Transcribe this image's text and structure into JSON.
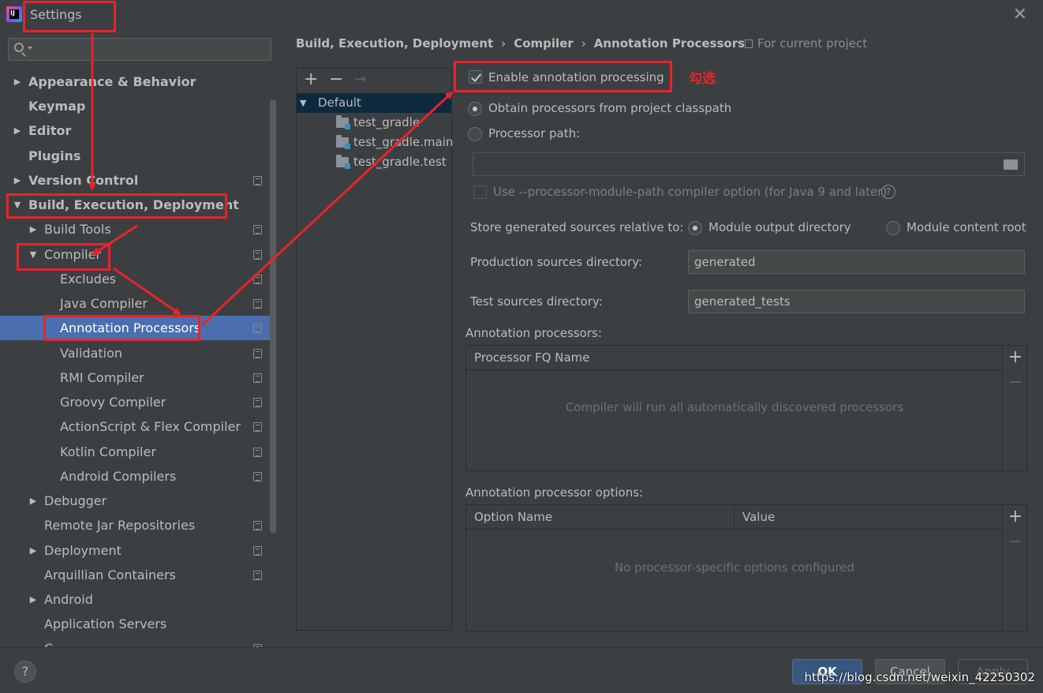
{
  "window": {
    "title": "Settings",
    "app_icon_text": "IJ"
  },
  "sidebar": {
    "search_placeholder": "",
    "items": [
      {
        "label": "Appearance & Behavior",
        "bold": true,
        "arrow": "▶",
        "proj": false
      },
      {
        "label": "Keymap",
        "bold": true,
        "arrow": "",
        "proj": false
      },
      {
        "label": "Editor",
        "bold": true,
        "arrow": "▶",
        "proj": false
      },
      {
        "label": "Plugins",
        "bold": true,
        "arrow": "",
        "proj": false
      },
      {
        "label": "Version Control",
        "bold": true,
        "arrow": "▶",
        "proj": true
      },
      {
        "label": "Build, Execution, Deployment",
        "bold": true,
        "arrow": "▼",
        "proj": false
      },
      {
        "label": "Build Tools",
        "bold": false,
        "arrow": "▶",
        "proj": true
      },
      {
        "label": "Compiler",
        "bold": false,
        "arrow": "▼",
        "proj": true
      },
      {
        "label": "Excludes",
        "bold": false,
        "arrow": "",
        "proj": true
      },
      {
        "label": "Java Compiler",
        "bold": false,
        "arrow": "",
        "proj": true
      },
      {
        "label": "Annotation Processors",
        "bold": false,
        "arrow": "",
        "proj": true,
        "selected": true
      },
      {
        "label": "Validation",
        "bold": false,
        "arrow": "",
        "proj": true
      },
      {
        "label": "RMI Compiler",
        "bold": false,
        "arrow": "",
        "proj": true
      },
      {
        "label": "Groovy Compiler",
        "bold": false,
        "arrow": "",
        "proj": true
      },
      {
        "label": "ActionScript & Flex Compiler",
        "bold": false,
        "arrow": "",
        "proj": true
      },
      {
        "label": "Kotlin Compiler",
        "bold": false,
        "arrow": "",
        "proj": true
      },
      {
        "label": "Android Compilers",
        "bold": false,
        "arrow": "",
        "proj": true
      },
      {
        "label": "Debugger",
        "bold": false,
        "arrow": "▶",
        "proj": false
      },
      {
        "label": "Remote Jar Repositories",
        "bold": false,
        "arrow": "",
        "proj": true
      },
      {
        "label": "Deployment",
        "bold": false,
        "arrow": "▶",
        "proj": true
      },
      {
        "label": "Arquillian Containers",
        "bold": false,
        "arrow": "",
        "proj": true
      },
      {
        "label": "Android",
        "bold": false,
        "arrow": "▶",
        "proj": false
      },
      {
        "label": "Application Servers",
        "bold": false,
        "arrow": "",
        "proj": false
      },
      {
        "label": "C",
        "bold": false,
        "arrow": "",
        "proj": true
      }
    ]
  },
  "breadcrumb": {
    "parts": [
      "Build, Execution, Deployment",
      "Compiler",
      "Annotation Processors"
    ],
    "separator": "›",
    "scope": "For current project"
  },
  "profiles": {
    "toolbar": {
      "add": "+",
      "remove": "−",
      "move": "→"
    },
    "items": [
      {
        "label": "Default",
        "arrow": "▼"
      },
      {
        "label": "test_gradle"
      },
      {
        "label": "test_gradle.main"
      },
      {
        "label": "test_gradle.test"
      }
    ]
  },
  "form": {
    "enable_label": "Enable annotation processing",
    "enable_checked": true,
    "obtain_label": "Obtain processors from project classpath",
    "processor_path_label": "Processor path:",
    "processor_path_value": "",
    "module_path_label": "Use --processor-module-path compiler option (for Java 9 and later)",
    "help_glyph": "?",
    "store_label": "Store generated sources relative to:",
    "store_options": [
      "Module output directory",
      "Module content root"
    ],
    "store_selected": 0,
    "production_label": "Production sources directory:",
    "production_value": "generated",
    "test_label": "Test sources directory:",
    "test_value": "generated_tests"
  },
  "processors_table": {
    "title": "Annotation processors:",
    "header": "Processor FQ Name",
    "empty_text": "Compiler will run all automatically discovered processors",
    "add": "+",
    "remove": "−"
  },
  "options_table": {
    "title": "Annotation processor options:",
    "headers": [
      "Option Name",
      "Value"
    ],
    "empty_text": "No processor-specific options configured",
    "add": "+",
    "remove": "−"
  },
  "footer": {
    "help": "?",
    "ok": "OK",
    "cancel": "Cancel",
    "apply": "Apply",
    "watermark": "https://blog.csdn.net/weixin_42250302"
  },
  "annotations": {
    "check_note": "勾选",
    "color": "#e8232b"
  },
  "colors": {
    "background": "#3c3f41",
    "selection": "#4b6eaf",
    "primary_button": "#365880",
    "text": "#bbbbbb"
  }
}
